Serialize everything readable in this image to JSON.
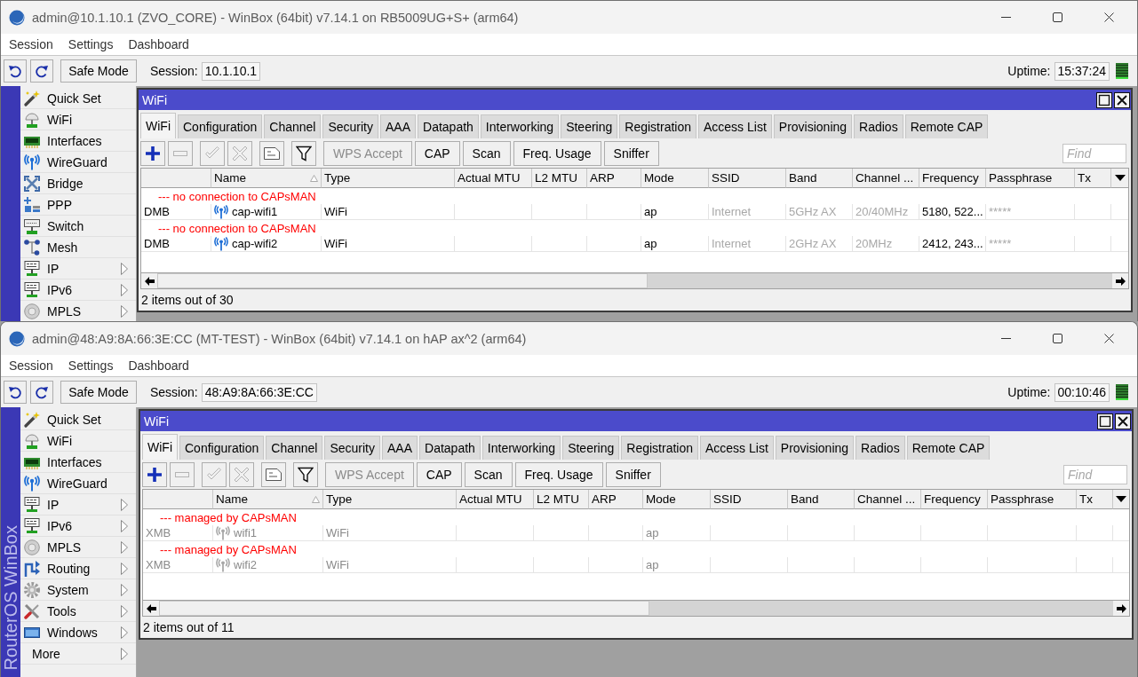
{
  "windows": [
    {
      "title": "admin@10.1.10.1 (ZVO_CORE) - WinBox (64bit) v7.14.1 on RB5009UG+S+ (arm64)",
      "menu": [
        "Session",
        "Settings",
        "Dashboard"
      ],
      "toolbar": {
        "safe_mode": "Safe Mode",
        "session_label": "Session:",
        "session": "10.1.10.1",
        "uptime_label": "Uptime:",
        "uptime": "15:37:24"
      },
      "sidebar": {
        "items": [
          {
            "kind": "quickset",
            "label": "Quick Set",
            "submenu": false
          },
          {
            "kind": "wifi",
            "label": "WiFi",
            "submenu": false
          },
          {
            "kind": "interfaces",
            "label": "Interfaces",
            "submenu": false
          },
          {
            "kind": "wireguard",
            "label": "WireGuard",
            "submenu": false
          },
          {
            "kind": "bridge",
            "label": "Bridge",
            "submenu": false
          },
          {
            "kind": "ppp",
            "label": "PPP",
            "submenu": false
          },
          {
            "kind": "switch",
            "label": "Switch",
            "submenu": false
          },
          {
            "kind": "mesh",
            "label": "Mesh",
            "submenu": false
          },
          {
            "kind": "ip",
            "label": "IP",
            "submenu": true
          },
          {
            "kind": "ipv6",
            "label": "IPv6",
            "submenu": true
          },
          {
            "kind": "mpls",
            "label": "MPLS",
            "submenu": true
          }
        ]
      },
      "panel": {
        "title": "WiFi",
        "tabs": [
          {
            "label": "WiFi",
            "selected": true
          },
          {
            "label": "Configuration",
            "selected": false
          },
          {
            "label": "Channel",
            "selected": false
          },
          {
            "label": "Security",
            "selected": false
          },
          {
            "label": "AAA",
            "selected": false
          },
          {
            "label": "Datapath",
            "selected": false
          },
          {
            "label": "Interworking",
            "selected": false
          },
          {
            "label": "Steering",
            "selected": false
          },
          {
            "label": "Registration",
            "selected": false
          },
          {
            "label": "Access List",
            "selected": false
          },
          {
            "label": "Provisioning",
            "selected": false
          },
          {
            "label": "Radios",
            "selected": false
          },
          {
            "label": "Remote CAP",
            "selected": false
          }
        ],
        "tools": [
          {
            "kind": "add",
            "disabled": false
          },
          {
            "kind": "remove",
            "disabled": true
          },
          {
            "kind": "enable",
            "disabled": true
          },
          {
            "kind": "disable",
            "disabled": true
          },
          {
            "kind": "comment",
            "disabled": false
          },
          {
            "kind": "filter",
            "disabled": false
          },
          {
            "kind": "text",
            "label": "WPS Accept",
            "disabled": true
          },
          {
            "kind": "text",
            "label": "CAP",
            "disabled": false
          },
          {
            "kind": "text",
            "label": "Scan",
            "disabled": false
          },
          {
            "kind": "text",
            "label": "Freq. Usage",
            "disabled": false
          },
          {
            "kind": "text",
            "label": "Sniffer",
            "disabled": false
          }
        ],
        "find": {
          "placeholder": "Find"
        },
        "columns": [
          {
            "sorted": false
          },
          {
            "label": "Name",
            "sorted": true
          },
          {
            "label": "Type",
            "sorted": false
          },
          {
            "label": "Actual MTU",
            "sorted": false
          },
          {
            "label": "L2 MTU",
            "sorted": false
          },
          {
            "label": "ARP",
            "sorted": false
          },
          {
            "label": "Mode",
            "sorted": false
          },
          {
            "label": "SSID",
            "sorted": false
          },
          {
            "label": "Band",
            "sorted": false
          },
          {
            "label": "Channel ...",
            "sorted": false
          },
          {
            "label": "Frequency",
            "sorted": false
          },
          {
            "label": "Passphrase",
            "sorted": false
          },
          {
            "label": "Tx",
            "sorted": false
          }
        ],
        "rows": [
          {
            "kind": "comment",
            "text": "--- no connection to CAPsMAN"
          },
          {
            "kind": "entry",
            "disabled": false,
            "cells": {
              "flags": {
                "text": "DMB",
                "dim": false
              },
              "name": {
                "text": "cap-wifi1",
                "dim": false
              },
              "type": {
                "text": "WiFi",
                "dim": false
              },
              "mode": {
                "text": "ap",
                "dim": false
              },
              "ssid": {
                "text": "Internet",
                "dim": true
              },
              "band": {
                "text": "5GHz AX",
                "dim": true
              },
              "channel": {
                "text": "20/40MHz",
                "dim": true
              },
              "frequency": {
                "text": "5180, 522...",
                "dim": false
              },
              "passphrase": {
                "text": "*****",
                "dim": true
              }
            }
          },
          {
            "kind": "comment",
            "text": "--- no connection to CAPsMAN"
          },
          {
            "kind": "entry",
            "disabled": false,
            "cells": {
              "flags": {
                "text": "DMB",
                "dim": false
              },
              "name": {
                "text": "cap-wifi2",
                "dim": false
              },
              "type": {
                "text": "WiFi",
                "dim": false
              },
              "mode": {
                "text": "ap",
                "dim": false
              },
              "ssid": {
                "text": "Internet",
                "dim": true
              },
              "band": {
                "text": "2GHz AX",
                "dim": true
              },
              "channel": {
                "text": "20MHz",
                "dim": true
              },
              "frequency": {
                "text": "2412, 243...",
                "dim": false
              },
              "passphrase": {
                "text": "*****",
                "dim": true
              }
            }
          }
        ],
        "status": "2 items out of 30"
      }
    },
    {
      "title": "admin@48:A9:8A:66:3E:CC (MT-TEST) - WinBox (64bit) v7.14.1 on hAP ax^2 (arm64)",
      "menu": [
        "Session",
        "Settings",
        "Dashboard"
      ],
      "toolbar": {
        "safe_mode": "Safe Mode",
        "session_label": "Session:",
        "session": "48:A9:8A:66:3E:CC",
        "uptime_label": "Uptime:",
        "uptime": "00:10:46"
      },
      "sidebar": {
        "brand": "RouterOS WinBox",
        "items": [
          {
            "kind": "quickset",
            "label": "Quick Set",
            "submenu": false
          },
          {
            "kind": "wifi",
            "label": "WiFi",
            "submenu": false
          },
          {
            "kind": "interfaces",
            "label": "Interfaces",
            "submenu": false
          },
          {
            "kind": "wireguard",
            "label": "WireGuard",
            "submenu": false
          },
          {
            "kind": "ip",
            "label": "IP",
            "submenu": true
          },
          {
            "kind": "ipv6",
            "label": "IPv6",
            "submenu": true
          },
          {
            "kind": "mpls",
            "label": "MPLS",
            "submenu": true
          },
          {
            "kind": "routing",
            "label": "Routing",
            "submenu": true
          },
          {
            "kind": "system",
            "label": "System",
            "submenu": true
          },
          {
            "kind": "tools",
            "label": "Tools",
            "submenu": true
          },
          {
            "kind": "windows",
            "label": "Windows",
            "submenu": true
          },
          {
            "kind": "more",
            "label": "More",
            "submenu": true
          }
        ]
      },
      "panel": {
        "title": "WiFi",
        "tabs": [
          {
            "label": "WiFi",
            "selected": true
          },
          {
            "label": "Configuration",
            "selected": false
          },
          {
            "label": "Channel",
            "selected": false
          },
          {
            "label": "Security",
            "selected": false
          },
          {
            "label": "AAA",
            "selected": false
          },
          {
            "label": "Datapath",
            "selected": false
          },
          {
            "label": "Interworking",
            "selected": false
          },
          {
            "label": "Steering",
            "selected": false
          },
          {
            "label": "Registration",
            "selected": false
          },
          {
            "label": "Access List",
            "selected": false
          },
          {
            "label": "Provisioning",
            "selected": false
          },
          {
            "label": "Radios",
            "selected": false
          },
          {
            "label": "Remote CAP",
            "selected": false
          }
        ],
        "tools": [
          {
            "kind": "add",
            "disabled": false
          },
          {
            "kind": "remove",
            "disabled": true
          },
          {
            "kind": "enable",
            "disabled": true
          },
          {
            "kind": "disable",
            "disabled": true
          },
          {
            "kind": "comment",
            "disabled": false
          },
          {
            "kind": "filter",
            "disabled": false
          },
          {
            "kind": "text",
            "label": "WPS Accept",
            "disabled": true
          },
          {
            "kind": "text",
            "label": "CAP",
            "disabled": false
          },
          {
            "kind": "text",
            "label": "Scan",
            "disabled": false
          },
          {
            "kind": "text",
            "label": "Freq. Usage",
            "disabled": false
          },
          {
            "kind": "text",
            "label": "Sniffer",
            "disabled": false
          }
        ],
        "find": {
          "placeholder": "Find"
        },
        "columns": [
          {
            "sorted": false
          },
          {
            "label": "Name",
            "sorted": true
          },
          {
            "label": "Type",
            "sorted": false
          },
          {
            "label": "Actual MTU",
            "sorted": false
          },
          {
            "label": "L2 MTU",
            "sorted": false
          },
          {
            "label": "ARP",
            "sorted": false
          },
          {
            "label": "Mode",
            "sorted": false
          },
          {
            "label": "SSID",
            "sorted": false
          },
          {
            "label": "Band",
            "sorted": false
          },
          {
            "label": "Channel ...",
            "sorted": false
          },
          {
            "label": "Frequency",
            "sorted": false
          },
          {
            "label": "Passphrase",
            "sorted": false
          },
          {
            "label": "Tx",
            "sorted": false
          }
        ],
        "rows": [
          {
            "kind": "comment",
            "text": "--- managed by CAPsMAN"
          },
          {
            "kind": "entry",
            "disabled": true,
            "cells": {
              "flags": {
                "text": "XMB",
                "dim": false
              },
              "name": {
                "text": "wifi1",
                "dim": false
              },
              "type": {
                "text": "WiFi",
                "dim": false
              },
              "mode": {
                "text": "ap",
                "dim": false
              }
            }
          },
          {
            "kind": "comment",
            "text": "--- managed by CAPsMAN"
          },
          {
            "kind": "entry",
            "disabled": true,
            "cells": {
              "flags": {
                "text": "XMB",
                "dim": false
              },
              "name": {
                "text": "wifi2",
                "dim": false
              },
              "type": {
                "text": "WiFi",
                "dim": false
              },
              "mode": {
                "text": "ap",
                "dim": false
              }
            }
          }
        ],
        "status": "2 items out of 11"
      }
    }
  ]
}
